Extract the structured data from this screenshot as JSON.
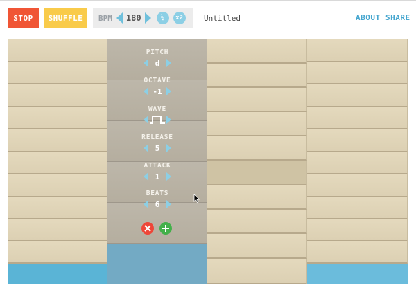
{
  "toolbar": {
    "stop_label": "STOP",
    "shuffle_label": "SHUFFLE",
    "bpm_label": "BPM",
    "bpm_value": "180",
    "half_label": "½",
    "double_label": "x2",
    "song_title": "Untitled",
    "about_label": "ABOUT",
    "share_label": "SHARE"
  },
  "controls": {
    "pitch": {
      "label": "PITCH",
      "value": "d"
    },
    "octave": {
      "label": "OCTAVE",
      "value": "-1"
    },
    "wave": {
      "label": "WAVE",
      "value": "square-wave-icon"
    },
    "release": {
      "label": "RELEASE",
      "value": "5"
    },
    "attack": {
      "label": "ATTACK",
      "value": "1"
    },
    "beats": {
      "label": "BEATS",
      "value": "6"
    }
  },
  "colors": {
    "stop": "#f05535",
    "shuffle": "#f9cb4a",
    "accent": "#45a6cf",
    "water": "#5ab4d6",
    "delete": "#ee4638",
    "add": "#43b04a"
  }
}
